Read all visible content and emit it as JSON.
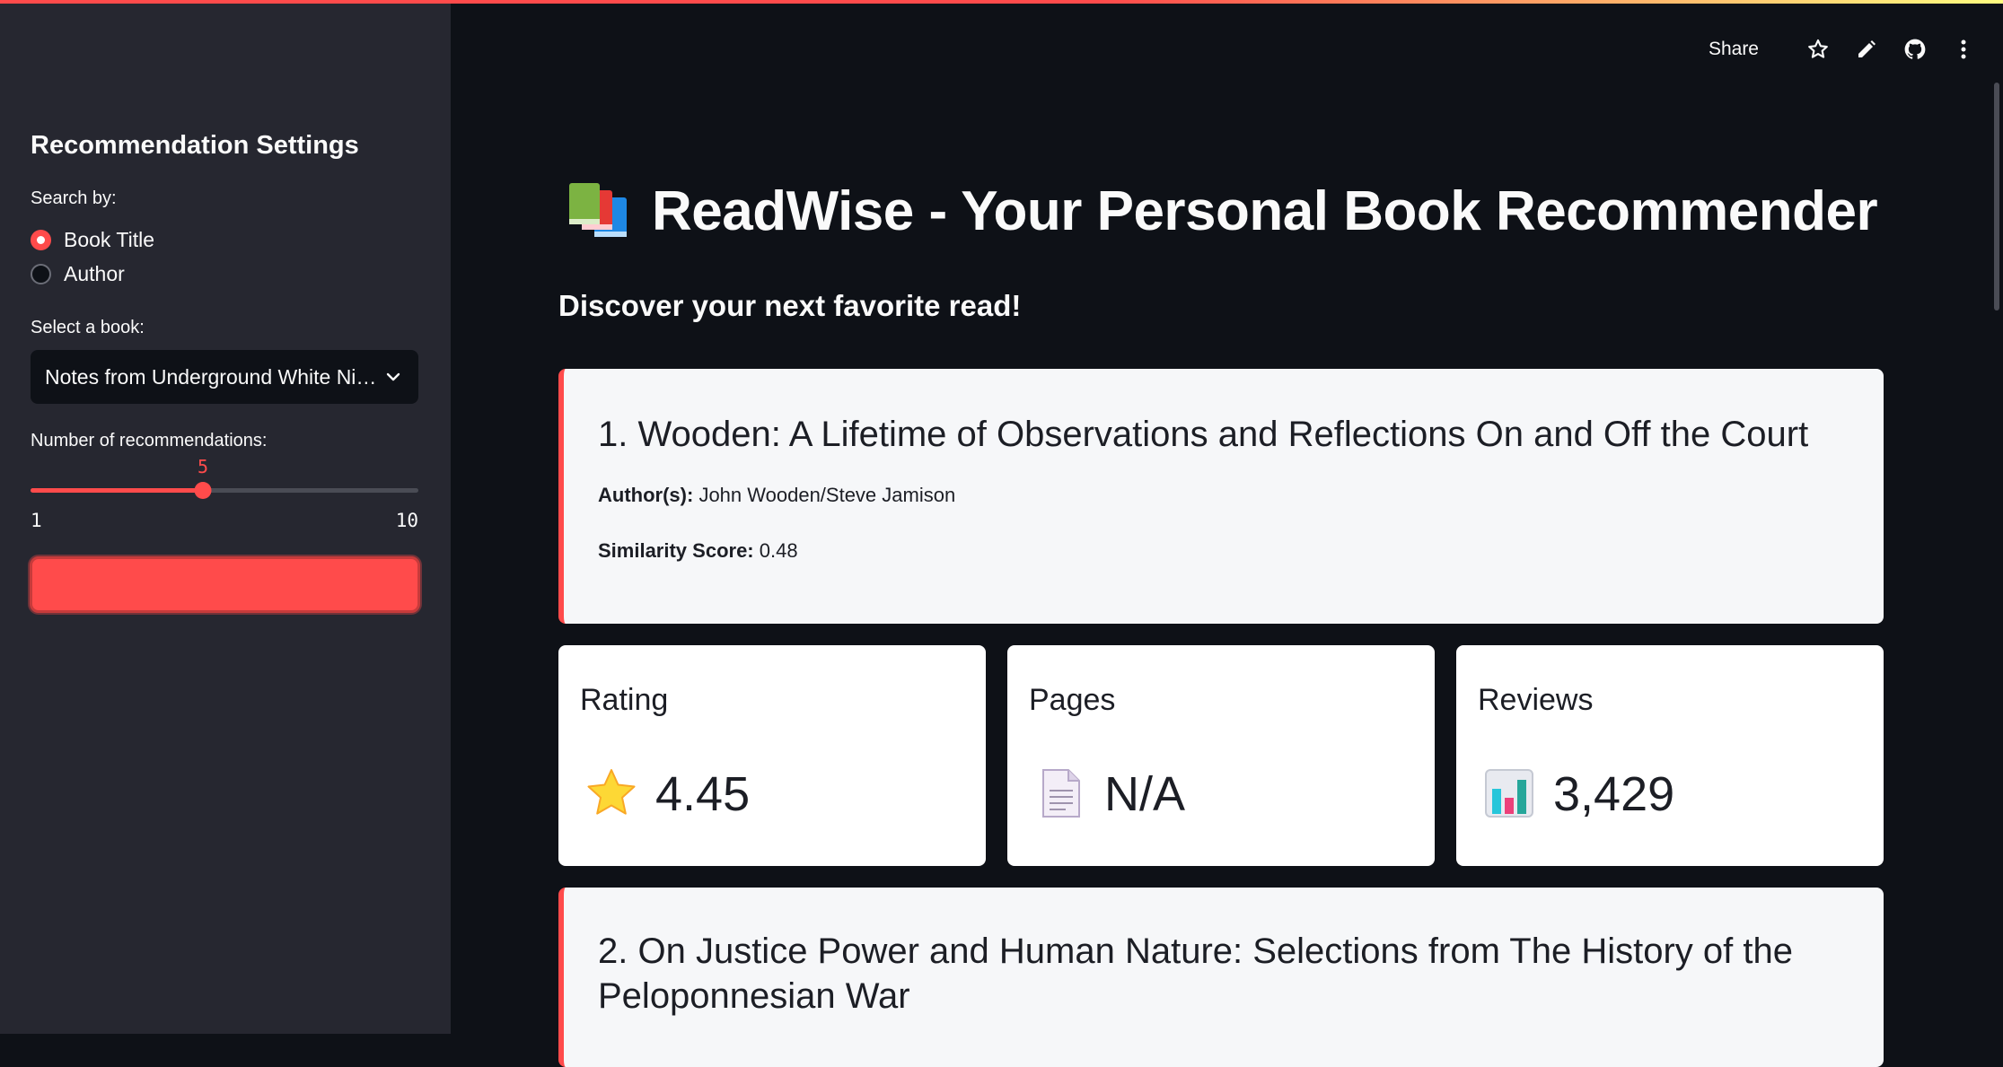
{
  "sidebar": {
    "title": "Recommendation Settings",
    "search_by_label": "Search by:",
    "search_options": [
      {
        "label": "Book Title",
        "selected": true
      },
      {
        "label": "Author",
        "selected": false
      }
    ],
    "select_book_label": "Select a book:",
    "selected_book": "Notes from Underground White Nights The Dream of a Ridiculous Man and Selections from The House of the Dead",
    "num_recs_label": "Number of recommendations:",
    "slider": {
      "value": "5",
      "min": "1",
      "max": "10",
      "fraction": 0.444
    },
    "action_button_label": ""
  },
  "toolbar": {
    "share_label": "Share",
    "icons": [
      "star-icon",
      "pencil-icon",
      "github-icon",
      "kebab-menu-icon"
    ]
  },
  "main": {
    "title": "ReadWise - Your Personal Book Recommender",
    "title_icon": "books-emoji-icon",
    "subtitle": "Discover your next favorite read!",
    "recommendations": [
      {
        "title": "1. Wooden: A Lifetime of Observations and Reflections On and Off the Court",
        "author_label": "Author(s):",
        "author": "John Wooden/Steve Jamison",
        "similarity_label": "Similarity Score:",
        "similarity": "0.48",
        "metrics": [
          {
            "label": "Rating",
            "icon": "star-emoji-icon",
            "value": "4.45"
          },
          {
            "label": "Pages",
            "icon": "page-emoji-icon",
            "value": "N/A"
          },
          {
            "label": "Reviews",
            "icon": "bar-chart-emoji-icon",
            "value": "3,429"
          }
        ]
      },
      {
        "title_line1": "2. On Justice Power and Human Nature: Selections from The History of the",
        "title_line2": "Peloponnesian War"
      }
    ]
  },
  "colors": {
    "accent": "#ff4b4b",
    "background": "#0e1117",
    "sidebar": "#262730",
    "card": "#f6f7f9"
  }
}
